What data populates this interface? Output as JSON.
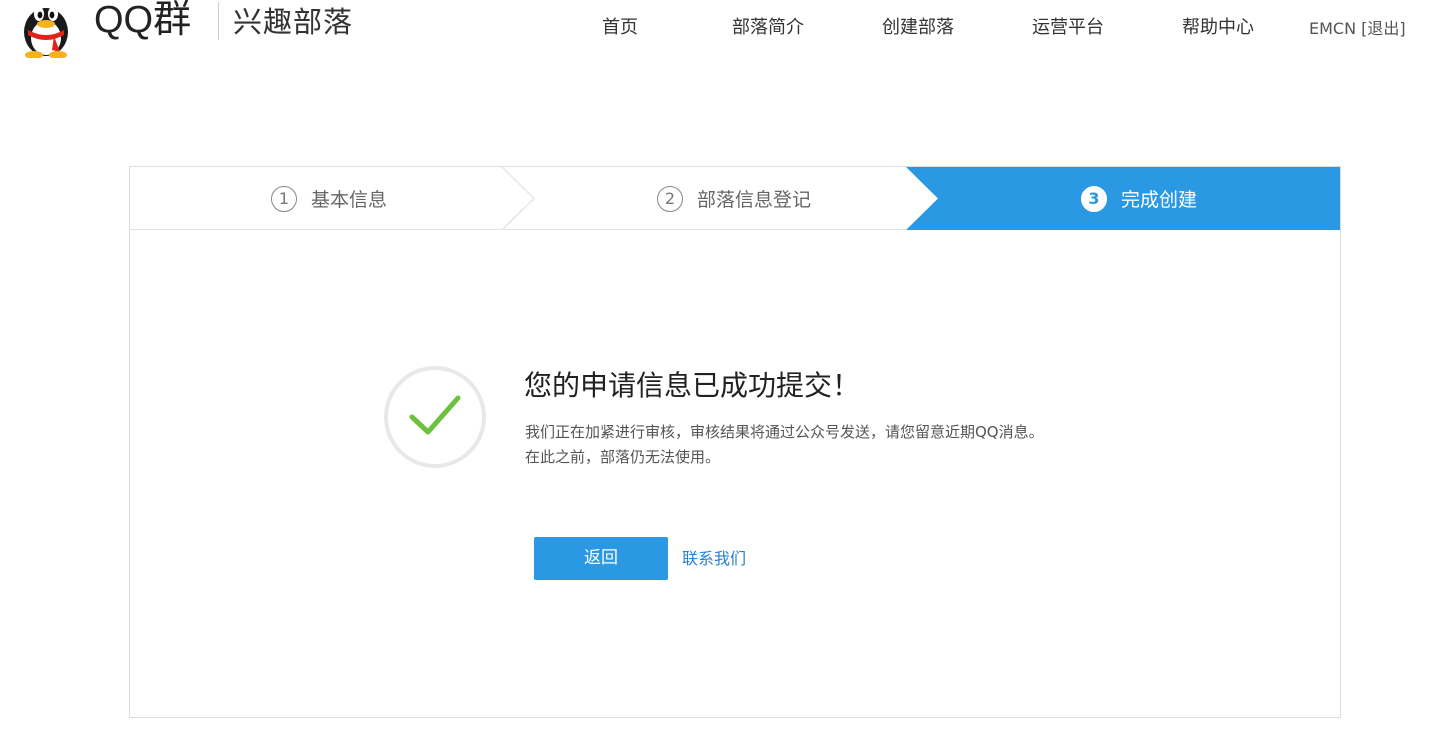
{
  "header": {
    "brand": "QQ群",
    "brand_sub": "兴趣部落",
    "nav": [
      "首页",
      "部落简介",
      "创建部落",
      "运营平台",
      "帮助中心"
    ],
    "user": "EMCN",
    "logout": "[退出]"
  },
  "steps": [
    {
      "num": "1",
      "label": "基本信息",
      "state": "done"
    },
    {
      "num": "2",
      "label": "部落信息登记",
      "state": "done"
    },
    {
      "num": "3",
      "label": "完成创建",
      "state": "active"
    }
  ],
  "result": {
    "title": "您的申请信息已成功提交！",
    "desc_line1": "我们正在加紧进行审核，审核结果将通过公众号发送，请您留意近期QQ消息。",
    "desc_line2": "在此之前，部落仍无法使用。",
    "back_button": "返回",
    "contact_link": "联系我们"
  },
  "colors": {
    "accent": "#2a98e3",
    "success": "#6cc23e",
    "link": "#2a7fd0"
  },
  "icons": {
    "logo": "qq-penguin-icon",
    "status": "checkmark-circle-icon"
  }
}
